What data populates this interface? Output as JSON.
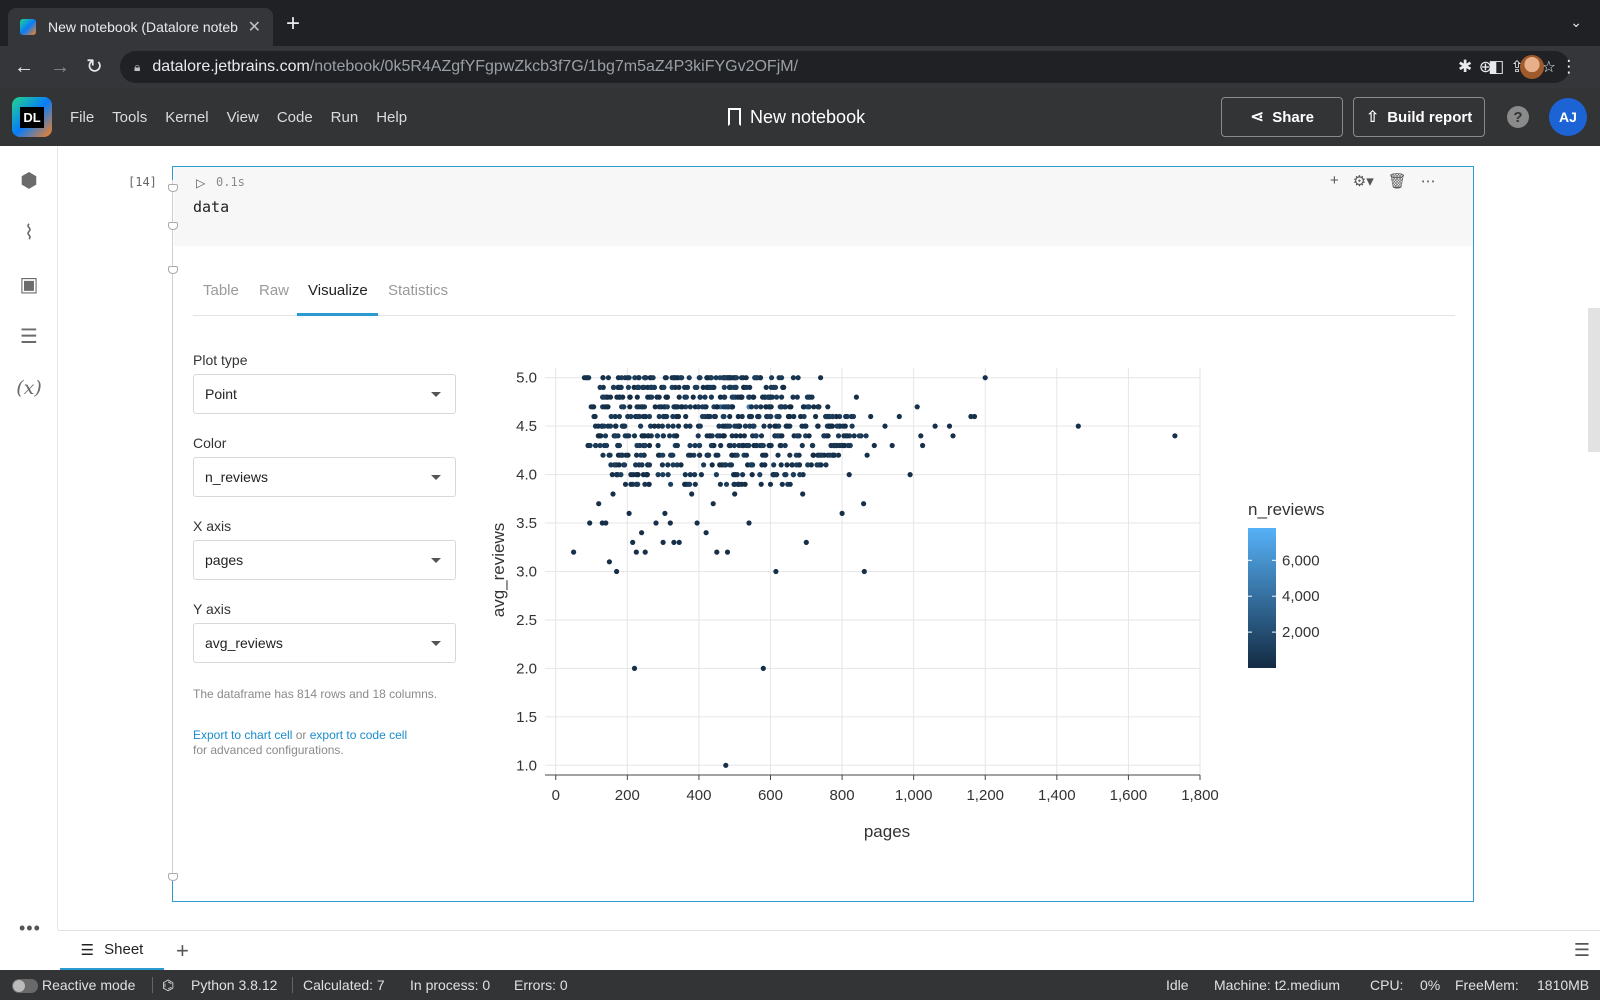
{
  "browser": {
    "tab_title": "New notebook (Datalore noteb",
    "url_host": "datalore.jetbrains.com",
    "url_path": "/notebook/0k5R4AZgfYFgpwZkcb3f7G/1bg7m5aZ4P3kiFYGv2OFjM/"
  },
  "app": {
    "logo_text": "DL",
    "menu": [
      "File",
      "Tools",
      "Kernel",
      "View",
      "Code",
      "Run",
      "Help"
    ],
    "notebook_title": "New notebook",
    "share_label": "Share",
    "build_report_label": "Build report",
    "help_label": "?",
    "avatar_initials": "AJ"
  },
  "rail": {
    "variables_label": "(x)"
  },
  "cell": {
    "exec_count": "[14]",
    "runtime": "0.1s",
    "code": "data",
    "tabs": [
      "Table",
      "Raw",
      "Visualize",
      "Statistics"
    ],
    "active_tab": "Visualize",
    "plot_type_label": "Plot type",
    "plot_type_value": "Point",
    "color_label": "Color",
    "color_value": "n_reviews",
    "x_axis_label": "X axis",
    "x_axis_value": "pages",
    "y_axis_label": "Y axis",
    "y_axis_value": "avg_reviews",
    "note_shape": "The dataframe has 814 rows and 18 columns.",
    "export_chart_link": "Export to chart cell",
    "or_text": " or ",
    "export_code_link": "export to code cell",
    "note_adv": "for advanced configurations."
  },
  "chart_data": {
    "type": "scatter",
    "xlabel": "pages",
    "ylabel": "avg_reviews",
    "xlim": [
      -30,
      1800
    ],
    "ylim": [
      0.9,
      5.1
    ],
    "xticks": [
      0,
      200,
      400,
      600,
      800,
      1000,
      1200,
      1400,
      1600,
      1800
    ],
    "xtick_labels": [
      "0",
      "200",
      "400",
      "600",
      "800",
      "1,000",
      "1,200",
      "1,400",
      "1,600",
      "1,800"
    ],
    "yticks": [
      1.0,
      1.5,
      2.0,
      2.5,
      3.0,
      3.5,
      4.0,
      4.5,
      5.0
    ],
    "ytick_labels": [
      "1.0",
      "1.5",
      "2.0",
      "2.5",
      "3.0",
      "3.5",
      "4.0",
      "4.5",
      "5.0"
    ],
    "grid": true,
    "colorbar": {
      "title": "n_reviews",
      "ticks": [
        2000,
        4000,
        6000
      ],
      "tick_labels": [
        "2,000",
        "4,000",
        "6,000"
      ],
      "range": [
        0,
        7800
      ],
      "color_low": "#132b43",
      "color_high": "#56b1f7"
    },
    "points": [
      [
        50,
        3.2
      ],
      [
        80,
        5.0
      ],
      [
        90,
        4.3
      ],
      [
        95,
        3.5
      ],
      [
        110,
        4.6
      ],
      [
        120,
        3.7
      ],
      [
        130,
        3.5
      ],
      [
        140,
        3.5
      ],
      [
        150,
        3.1
      ],
      [
        160,
        3.8
      ],
      [
        170,
        3.0
      ],
      [
        180,
        4.2
      ],
      [
        195,
        3.9
      ],
      [
        205,
        3.6
      ],
      [
        210,
        4.0
      ],
      [
        215,
        3.3
      ],
      [
        220,
        2.0
      ],
      [
        225,
        3.2
      ],
      [
        240,
        3.4
      ],
      [
        250,
        3.2
      ],
      [
        260,
        3.9
      ],
      [
        280,
        3.5
      ],
      [
        300,
        3.3
      ],
      [
        305,
        3.6
      ],
      [
        320,
        3.5
      ],
      [
        330,
        3.3
      ],
      [
        345,
        3.3
      ],
      [
        360,
        3.9
      ],
      [
        380,
        3.8
      ],
      [
        395,
        3.5
      ],
      [
        420,
        3.4
      ],
      [
        440,
        3.7
      ],
      [
        450,
        3.2
      ],
      [
        475,
        1.0
      ],
      [
        480,
        3.2
      ],
      [
        500,
        3.8
      ],
      [
        520,
        3.9
      ],
      [
        540,
        3.5
      ],
      [
        580,
        2.0
      ],
      [
        600,
        3.9
      ],
      [
        615,
        3.0
      ],
      [
        640,
        4.0
      ],
      [
        660,
        4.1
      ],
      [
        690,
        3.8
      ],
      [
        700,
        3.3
      ],
      [
        720,
        4.2
      ],
      [
        740,
        5.0
      ],
      [
        760,
        4.7
      ],
      [
        780,
        4.3
      ],
      [
        790,
        4.2
      ],
      [
        800,
        3.6
      ],
      [
        820,
        4.0
      ],
      [
        840,
        4.8
      ],
      [
        860,
        3.7
      ],
      [
        862,
        3.0
      ],
      [
        870,
        4.2
      ],
      [
        880,
        4.6
      ],
      [
        890,
        4.3
      ],
      [
        920,
        4.5
      ],
      [
        940,
        4.3
      ],
      [
        960,
        4.6
      ],
      [
        990,
        4.0
      ],
      [
        1010,
        4.7
      ],
      [
        1020,
        4.4
      ],
      [
        1025,
        4.3
      ],
      [
        1060,
        4.5
      ],
      [
        1100,
        4.5
      ],
      [
        1110,
        4.4
      ],
      [
        1160,
        4.6
      ],
      [
        1170,
        4.6
      ],
      [
        1200,
        5.0
      ],
      [
        1460,
        4.5
      ],
      [
        1730,
        4.4
      ],
      [
        700,
        4.7,
        6500
      ],
      [
        540,
        4.7,
        5200
      ],
      [
        460,
        4.7,
        3500
      ],
      [
        300,
        4.4,
        2800
      ],
      [
        600,
        4.6,
        2400
      ]
    ]
  },
  "bottom": {
    "sheet_tab": "Sheet",
    "reactive_mode": "Reactive mode",
    "python": "Python 3.8.12",
    "calculated": "Calculated: 7",
    "in_process": "In process: 0",
    "errors": "Errors: 0",
    "idle": "Idle",
    "machine": "Machine: t2.medium",
    "cpu": "CPU:",
    "cpu_value": "0%",
    "freemem": "FreeMem:",
    "freemem_value": "1810MB"
  }
}
